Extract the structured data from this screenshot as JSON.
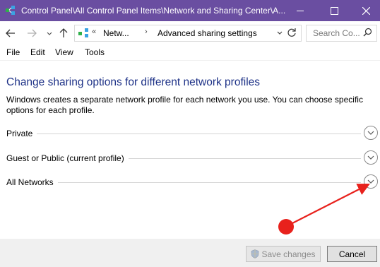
{
  "window": {
    "title": "Control Panel\\All Control Panel Items\\Network and Sharing Center\\A...",
    "title_bar_color": "#6a4ea1"
  },
  "nav": {
    "back_icon": "arrow-left-icon",
    "forward_icon": "arrow-right-icon",
    "recent_icon": "chevron-down-icon",
    "up_icon": "arrow-up-icon",
    "address": {
      "overflow": "«",
      "crumb1": "Netw...",
      "separator": "›",
      "crumb2": "Advanced sharing settings"
    },
    "search_placeholder": "Search Co..."
  },
  "menu": {
    "file": "File",
    "edit": "Edit",
    "view": "View",
    "tools": "Tools"
  },
  "content": {
    "heading": "Change sharing options for different network profiles",
    "heading_color": "#1e3287",
    "description": "Windows creates a separate network profile for each network you use. You can choose specific options for each profile.",
    "profiles": [
      {
        "label": "Private"
      },
      {
        "label": "Guest or Public (current profile)"
      },
      {
        "label": "All Networks"
      }
    ]
  },
  "footer": {
    "save_label": "Save changes",
    "cancel_label": "Cancel"
  },
  "annotation_color": "#e8211c"
}
